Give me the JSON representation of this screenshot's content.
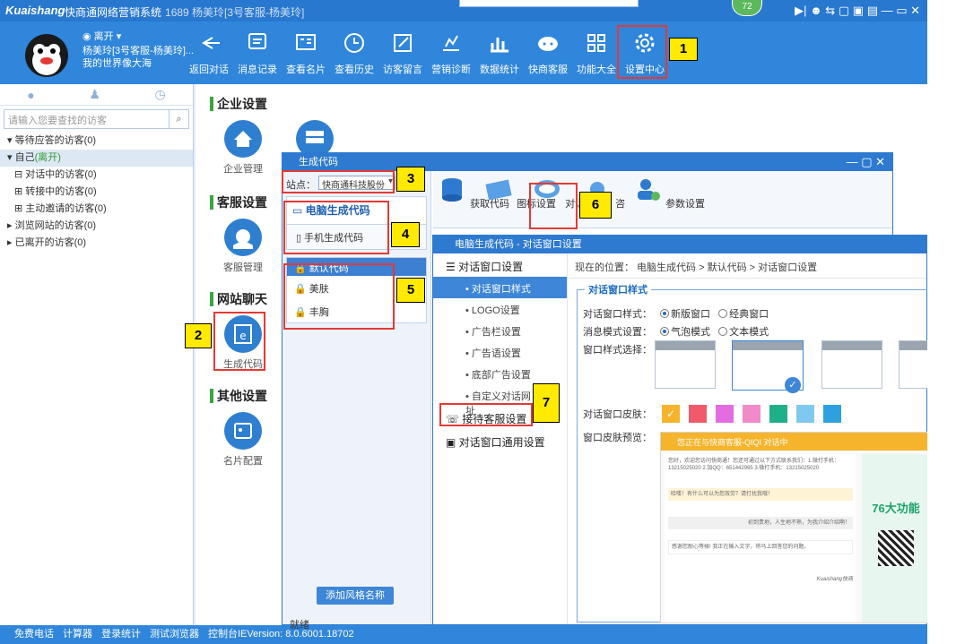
{
  "titlebar": {
    "brand": "Kuaishang",
    "app_title": "快商通网络营销系统",
    "user_info": "1689 杨美玲[3号客服-杨美玲]",
    "notif_count": "72",
    "window_buttons": "▶| ☻ ⇆ ▢ ▣ ▤ — ▭ ✕"
  },
  "user": {
    "status": "离开",
    "name": "杨美玲[3号客服-杨美玲]...",
    "signature": "我的世界像大海"
  },
  "toolbar": {
    "items": [
      {
        "label": "返回对话",
        "icon": "return-icon"
      },
      {
        "label": "消息记录",
        "icon": "message-record-icon"
      },
      {
        "label": "查看名片",
        "icon": "card-icon"
      },
      {
        "label": "查看历史",
        "icon": "history-icon"
      },
      {
        "label": "访客留言",
        "icon": "edit-icon"
      },
      {
        "label": "营销诊断",
        "icon": "diagnosis-icon"
      },
      {
        "label": "数据统计",
        "icon": "stats-icon"
      },
      {
        "label": "快商客服",
        "icon": "service-icon"
      },
      {
        "label": "功能大全",
        "icon": "grid-icon"
      },
      {
        "label": "设置中心",
        "icon": "gear-icon"
      }
    ]
  },
  "left": {
    "search_placeholder": "请输入您要查找的访客",
    "tree": [
      {
        "label": "▾ 等待应答的访客(0)"
      },
      {
        "label": "▾ 自己",
        "extra": "(离开)"
      },
      {
        "label": "⊟ 对话中的访客(0)"
      },
      {
        "label": "⊞ 转接中的访客(0)"
      },
      {
        "label": "⊞ 主动邀请的访客(0)"
      },
      {
        "label": "▸ 浏览网站的访客(0)"
      },
      {
        "label": "▸ 已离开的访客(0)"
      }
    ]
  },
  "main": {
    "sections": [
      {
        "title": "企业设置",
        "item": "企业管理"
      },
      {
        "title": "客服设置",
        "item": "客服管理"
      },
      {
        "title": "网站聊天",
        "item": "生成代码"
      },
      {
        "title": "其他设置",
        "item": "名片配置"
      }
    ]
  },
  "dialog1": {
    "title": "生成代码",
    "site_label": "站点：",
    "site_value": "快商通科技股份",
    "pc_code": "电脑生成代码",
    "mobile_code": "手机生成代码",
    "styles_header": "默认代码",
    "style_items": [
      "美肤",
      "丰胸"
    ],
    "add_button": "添加风格名称",
    "status": "就绪",
    "ribbon": [
      "获取代码",
      "图标设置",
      "对话窗口",
      "咨",
      "参数设置"
    ]
  },
  "dialog2": {
    "title": "电脑生成代码 - 对话窗口设置",
    "menu_group1": "对话窗口设置",
    "menu_items": [
      "对话窗口样式",
      "LOGO设置",
      "广告栏设置",
      "广告语设置",
      "底部广告设置",
      "自定义对话网址"
    ],
    "menu_group2": "接待客服设置",
    "menu_group3": "对话窗口通用设置",
    "crumb": "现在的位置：  电脑生成代码 > 默认代码 > 对话窗口设置",
    "legend": "对话窗口样式",
    "row_style_label": "对话窗口样式：",
    "style_opt1": "新版窗口",
    "style_opt2": "经典窗口",
    "row_msg_label": "消息模式设置：",
    "msg_opt1": "气泡模式",
    "msg_opt2": "文本模式",
    "row_select_label": "窗口样式选择：",
    "skin_label": "对话窗口皮肤：",
    "preview_label": "窗口皮肤预览：",
    "skins": [
      "#f6b42c",
      "#f05a6a",
      "#e36ce0",
      "#f08ac8",
      "#1fb08a",
      "#7fc8f0",
      "#2ea0e0"
    ],
    "preview_title": "您正在与快商客服-QIQI 对话中",
    "preview_text": "您好，欢迎您访问快商通！您还可通过以下方式联系我们：1.微打手机：13215025020 2.加QQ：651442965 3.微打手机：13215025020",
    "preview_msg1": "哈喽！有什么可以为您效劳？请打扰我哦！",
    "preview_msg2": "初到贵地，人生地不熟，为我介绍介绍啊！",
    "preview_msg3": "感谢您耐心等候! 我正在输入文字，将马上回答您的问题。",
    "preview_ad": "76大功能",
    "preview_brand": "Kuaishang快商"
  },
  "statusbar": [
    "免费电话",
    "计算器",
    "登录统计",
    "测试浏览器",
    "控制台IEVersion: 8.0.6001.18702"
  ],
  "callouts": [
    "1",
    "2",
    "3",
    "4",
    "5",
    "6",
    "7"
  ]
}
